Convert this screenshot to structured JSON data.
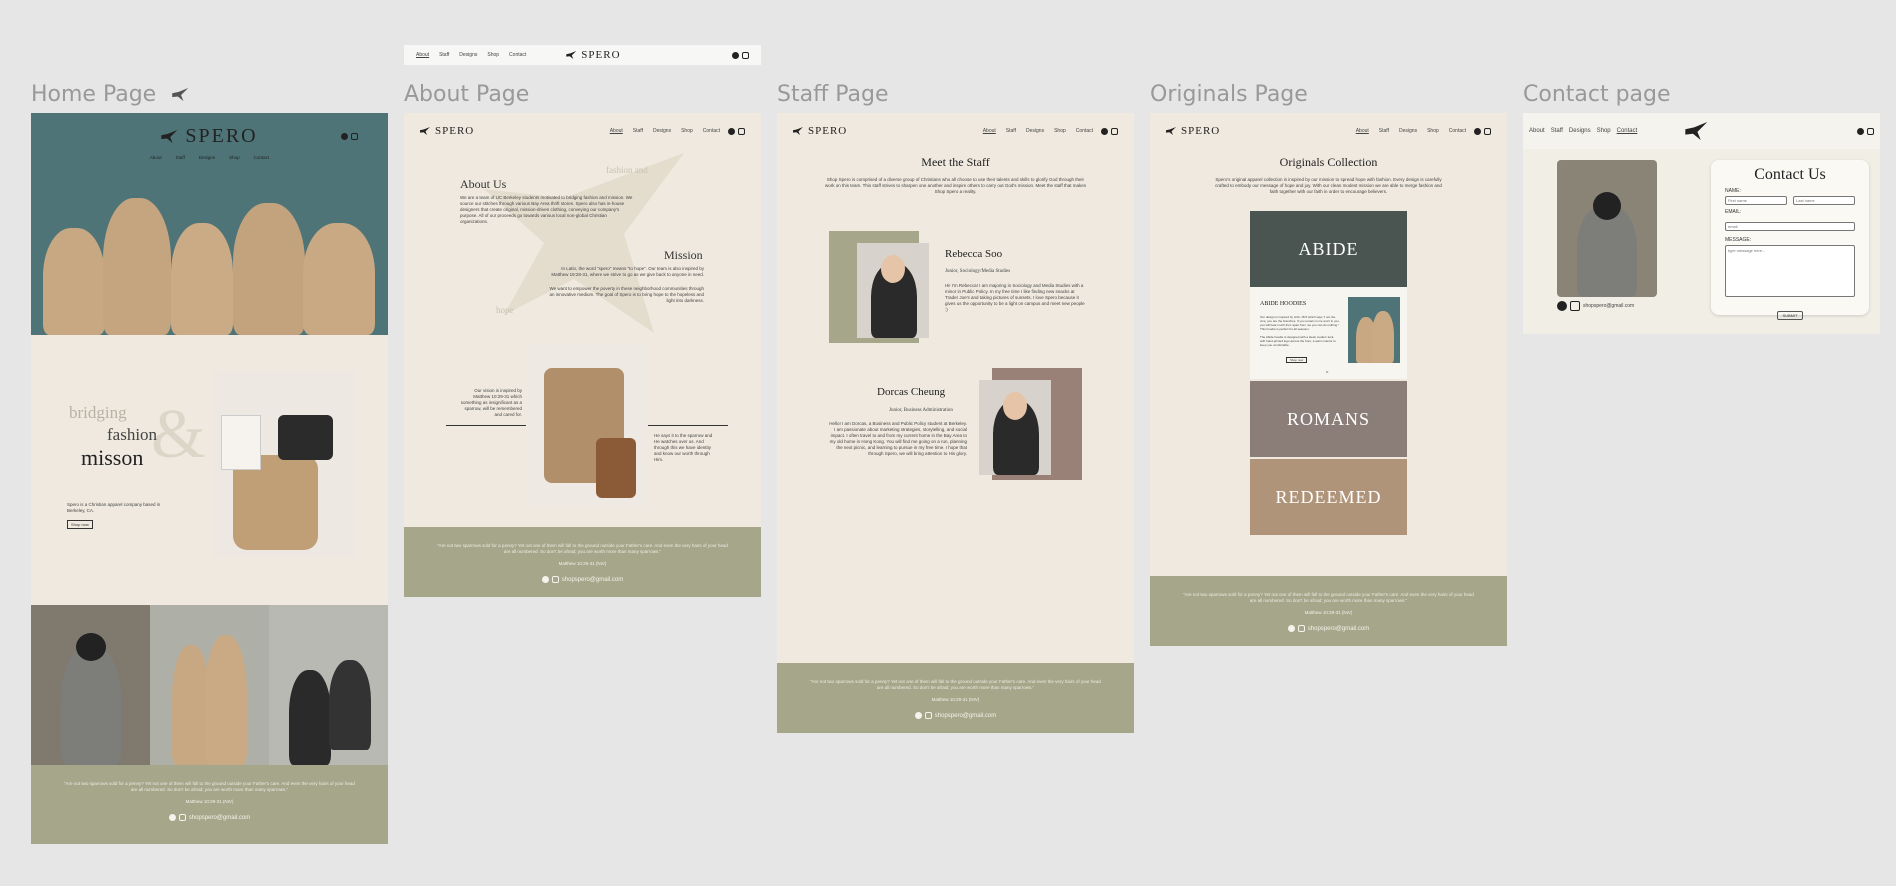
{
  "brand": "SPERO",
  "nav_links": [
    "About",
    "Staff",
    "Designs",
    "Shop",
    "Contact"
  ],
  "page_labels": {
    "home": "Home Page",
    "about": "About Page",
    "staff": "Staff Page",
    "originals": "Originals Page",
    "contact": "Contact page"
  },
  "home": {
    "bridging": "bridging",
    "fashion": "fashion",
    "mission": "misson",
    "amp": "&",
    "desc": "Spero is a Christian apparel company based in Berkeley, CA.",
    "shop_btn": "Shop now"
  },
  "about": {
    "title": "About Us",
    "intro": "We are a team of UC Berkeley students motivated to bridging fashion and mission. We source our stitches through various Bay Area thrift stores. Spero also has in-house designers that create original, mission-driven clothing, conveying our company's purpose. All of our proceeds go towards various local non-global Christian organizations.",
    "mission_title": "Mission",
    "mission_text": "In Latin, the word \"spero\" means \"to hope\". Our team is also inspired by Matthew 19:28-31, where we strive to go as we give back to anyone in need.",
    "mission_text2": "We want to empower the poverty in these neighborhood communities through an innovative medium. The goal of Spero is to bring hope to the hopeless and light into darkness.",
    "word_fashion": "fashion and",
    "word_hope": "hope",
    "quote_left": "Our vision is inspired by Matthew 10:29-31 which something as insignificant as a sparrow, will be remembered and cared for.",
    "quote_right": "He says it to the sparrow and He watches over us. And through this we have identity and know our worth through Him."
  },
  "footer": {
    "verse": "\"Are not two sparrows sold for a penny? Yet not one of them will fall to the ground outside your Father's care. And even the very hairs of your head are all numbered. So don't be afraid; you are worth more than many sparrows.\"",
    "ref": "Matthew 10:29-31 (NIV)",
    "email": "shopspero@gmail.com"
  },
  "staff": {
    "title": "Meet the Staff",
    "intro": "Shop Spero is comprised of a diverse group of Christians who all choose to use their talents and skills to glorify God through their work on this team. This staff strives to sharpen one another and inspire others to carry out God's mission. Meet the staff that makes Shop Spero a reality.",
    "members": [
      {
        "name": "Rebecca Soo",
        "role": "Junior, Sociology/Media Studies",
        "bio": "Hi! I'm Rebecca! I am majoring in Sociology and Media Studies with a minor in Public Policy. In my free time I like finding new snacks at Trader Joe's and taking pictures of sunsets. I love Spero because it gives us the opportunity to be a light on campus and meet new people :)"
      },
      {
        "name": "Dorcas Cheung",
        "role": "Junior, Business Administration",
        "bio": "Hello! I am Dorcas, a Business and Public Policy student at Berkeley. I am passionate about marketing strategies, storytelling, and social impact. I often travel to and from my current home in the Bay Area to my old home in Hong Kong. You will find me going on a run, planning the next picnic, and learning to pursue in my free time. I hope that through Spero, we will bring attention to His glory."
      }
    ]
  },
  "originals": {
    "title": "Originals Collection",
    "intro": "Spero's original apparel collection is inspired by our mission to spread hope with fashion. Every design is carefully crafted to embody our message of hope and joy. With our clean modest mission we are able to merge fashion and faith together with our faith in order to encourage believers.",
    "collections": [
      "ABIDE",
      "ROMANS",
      "REDEEMED"
    ],
    "abide_hoodies_title": "ABIDE HOODIES",
    "abide_hoodies_text": "Our design is inspired by John 15:5 which says \"I am the vine; you are the branches. If you remain in me and I in you, you will bear much fruit; apart from me you can do nothing.\" This hoodie is perfect for all seasons.",
    "abide_hoodies_text2": "The Abide hoodie is designed with a sleek modern look, with hand-printed logo across the front, a warm interior to keep you comfortable.",
    "shop_btn": "Shop now"
  },
  "contact": {
    "title": "Contact Us",
    "name_label": "NAME:",
    "first_placeholder": "First name",
    "last_placeholder": "Last name",
    "email_label": "EMAIL:",
    "email_placeholder": "email",
    "message_label": "MESSAGE:",
    "message_placeholder": "type message here...",
    "submit": "SUBMIT",
    "email": "shopspero@gmail.com"
  }
}
